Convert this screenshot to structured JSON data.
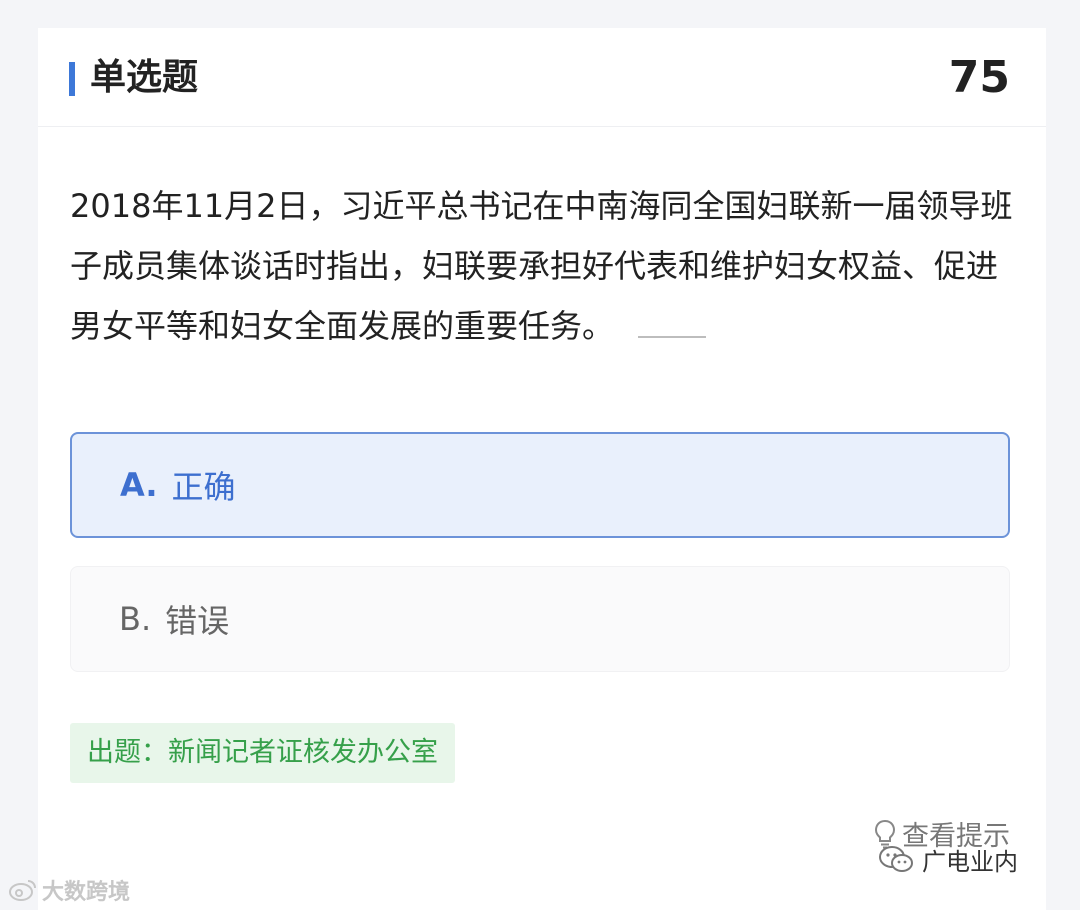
{
  "header": {
    "type_label": "单选题",
    "question_number": "75"
  },
  "question": {
    "text": "2018年11月2日，习近平总书记在中南海同全国妇联新一届领导班子成员集体谈话时指出，妇联要承担好代表和维护妇女权益、促进男女平等和妇女全面发展的重要任务。"
  },
  "options": [
    {
      "letter": "A.",
      "text": "正确",
      "selected": true
    },
    {
      "letter": "B.",
      "text": "错误",
      "selected": false
    }
  ],
  "source": {
    "label": "出题：新闻记者证核发办公室"
  },
  "hint": {
    "label": "查看提示",
    "icon": "lightbulb-icon"
  },
  "watermarks": {
    "right": "广电业内",
    "left": "大数跨境"
  },
  "colors": {
    "accent": "#3d78d8",
    "selected_bg": "#e9f0fc",
    "source_bg": "#e8f6ea",
    "source_text": "#36a04a"
  }
}
